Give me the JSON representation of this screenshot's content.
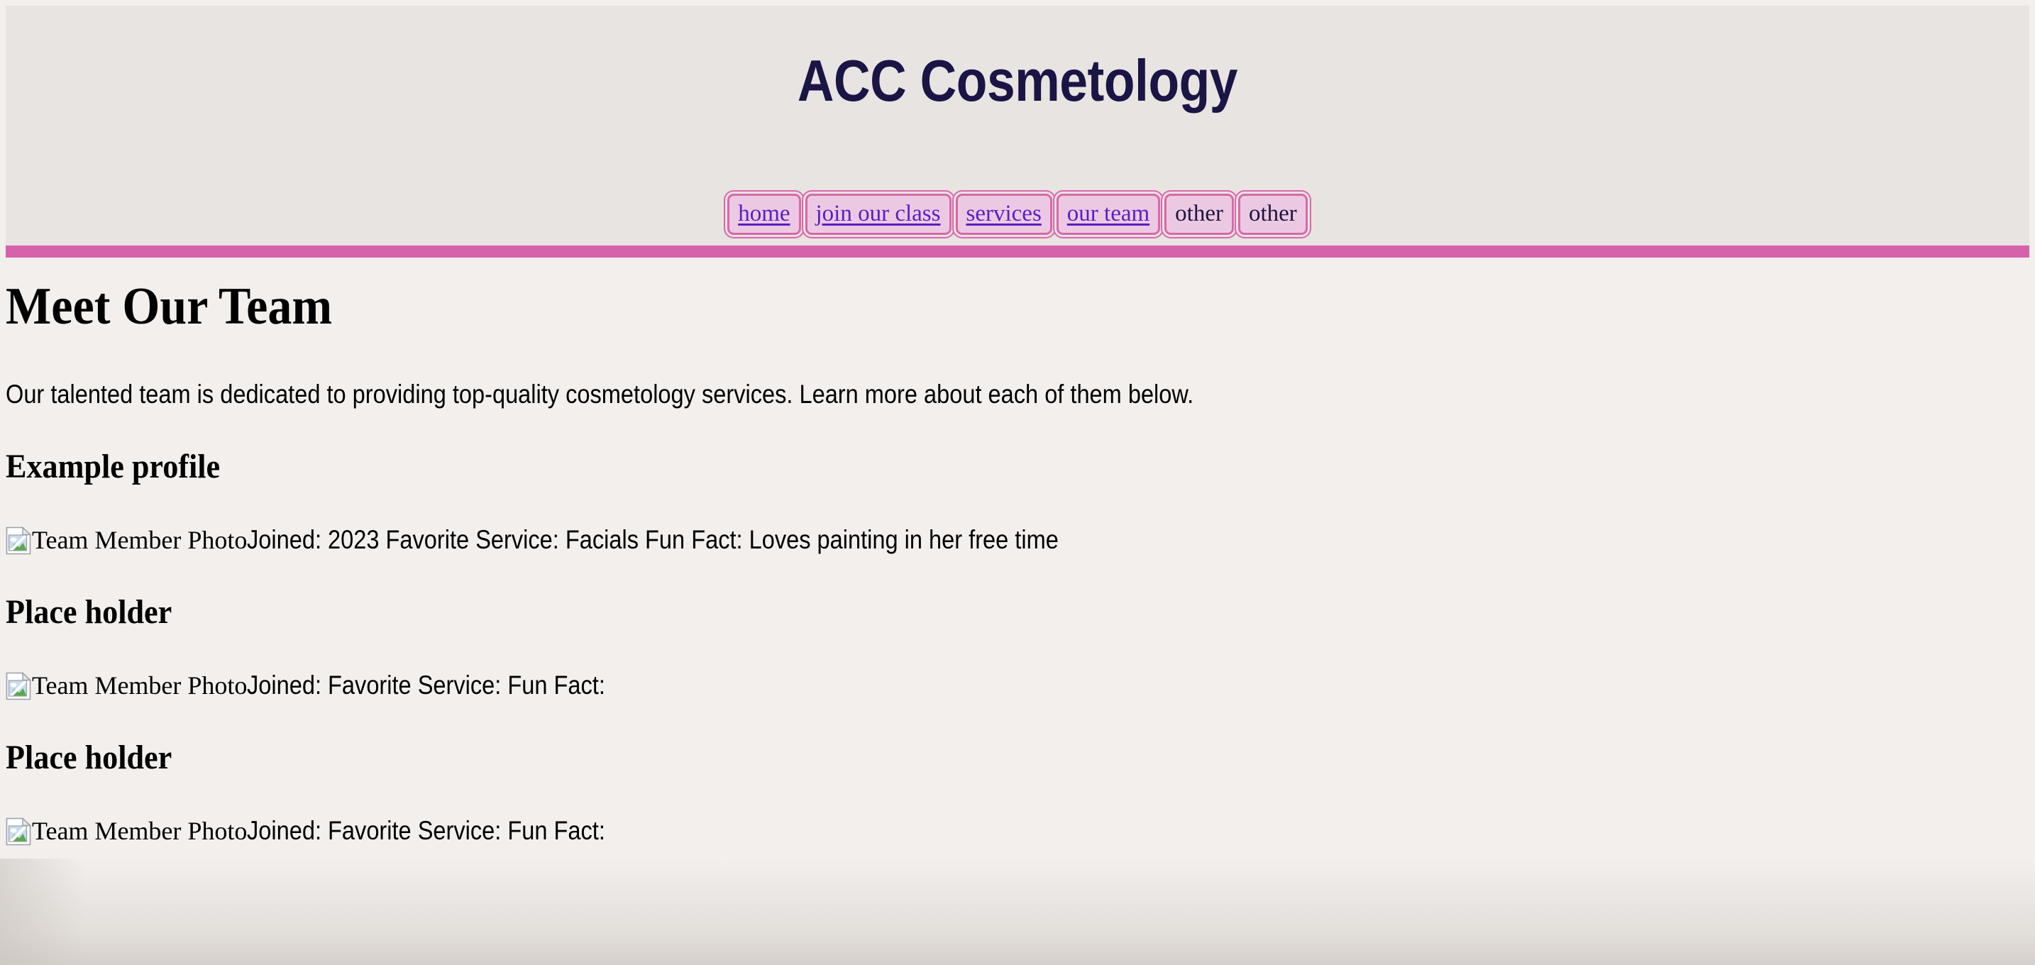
{
  "header": {
    "title": "ACC Cosmetology",
    "nav": [
      {
        "label": "home",
        "is_link": true
      },
      {
        "label": "join our class",
        "is_link": true
      },
      {
        "label": "services",
        "is_link": true
      },
      {
        "label": "our team",
        "is_link": true
      },
      {
        "label": "other",
        "is_link": false
      },
      {
        "label": "other",
        "is_link": false
      }
    ],
    "rule_color": "#d662ac"
  },
  "colors": {
    "page_background": "#f2efed",
    "header_background": "#e8e4e1",
    "title_text": "#1a1545",
    "nav_button_fill": "#ecc9e2",
    "nav_button_border": "#d968ac",
    "nav_link_text": "#5a1ec4",
    "nav_plain_text": "#1a1640",
    "body_text": "#000000",
    "accent_pink": "#d662ac"
  },
  "main": {
    "page_title": "Meet Our Team",
    "intro": "Our talented team is dedicated to providing top-quality cosmetology services. Learn more about each of them below.",
    "members": [
      {
        "name": "Example profile",
        "photo_alt": "Team Member Photo",
        "joined_label": "Joined:",
        "joined_value": "2023",
        "service_label": "Favorite Service:",
        "service_value": "Facials",
        "fun_fact_label": "Fun Fact:",
        "fun_fact_value": "Loves painting in her free time"
      },
      {
        "name": "Place holder",
        "photo_alt": "Team Member Photo",
        "joined_label": "Joined:",
        "joined_value": "",
        "service_label": "Favorite Service:",
        "service_value": "",
        "fun_fact_label": "Fun Fact:",
        "fun_fact_value": ""
      },
      {
        "name": "Place holder",
        "photo_alt": "Team Member Photo",
        "joined_label": "Joined:",
        "joined_value": "",
        "service_label": "Favorite Service:",
        "service_value": "",
        "fun_fact_label": "Fun Fact:",
        "fun_fact_value": ""
      }
    ]
  },
  "icons": {
    "broken_image": "broken-image-icon"
  }
}
